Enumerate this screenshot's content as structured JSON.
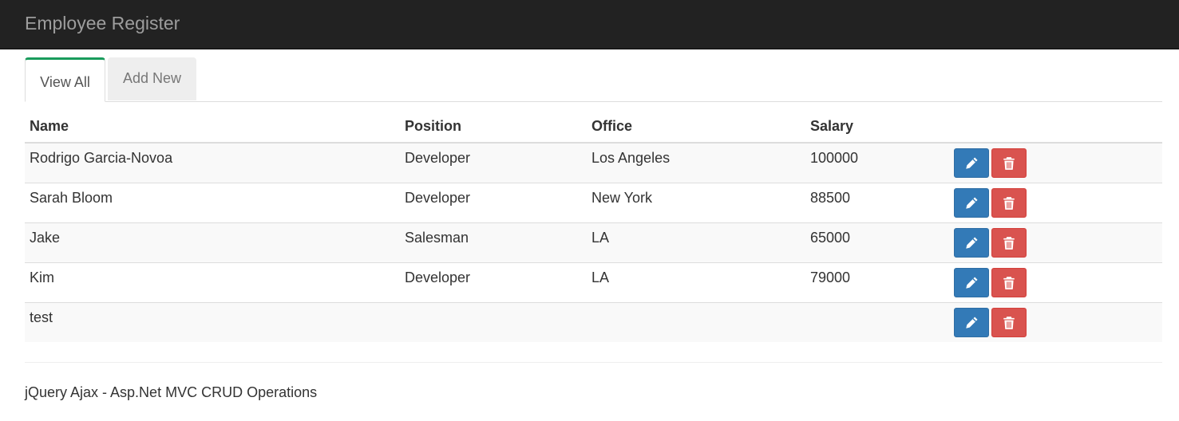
{
  "navbar": {
    "brand": "Employee Register"
  },
  "tabs": [
    {
      "label": "View All",
      "active": true
    },
    {
      "label": "Add New",
      "active": false
    }
  ],
  "table": {
    "headers": {
      "name": "Name",
      "position": "Position",
      "office": "Office",
      "salary": "Salary"
    },
    "rows": [
      {
        "name": "Rodrigo Garcia-Novoa",
        "position": "Developer",
        "office": "Los Angeles",
        "salary": "100000"
      },
      {
        "name": "Sarah Bloom",
        "position": "Developer",
        "office": "New York",
        "salary": "88500"
      },
      {
        "name": "Jake",
        "position": "Salesman",
        "office": "LA",
        "salary": "65000"
      },
      {
        "name": "Kim",
        "position": "Developer",
        "office": "LA",
        "salary": "79000"
      },
      {
        "name": "test",
        "position": "",
        "office": "",
        "salary": ""
      }
    ],
    "row_actions": {
      "edit_icon": "pencil-icon",
      "delete_icon": "trash-icon"
    }
  },
  "colors": {
    "navbar_bg": "#222222",
    "edit_button": "#337ab7",
    "delete_button": "#d9534f",
    "active_tab_accent": "#1a9c5c"
  },
  "footer": {
    "text": "jQuery Ajax - Asp.Net MVC CRUD Operations"
  }
}
